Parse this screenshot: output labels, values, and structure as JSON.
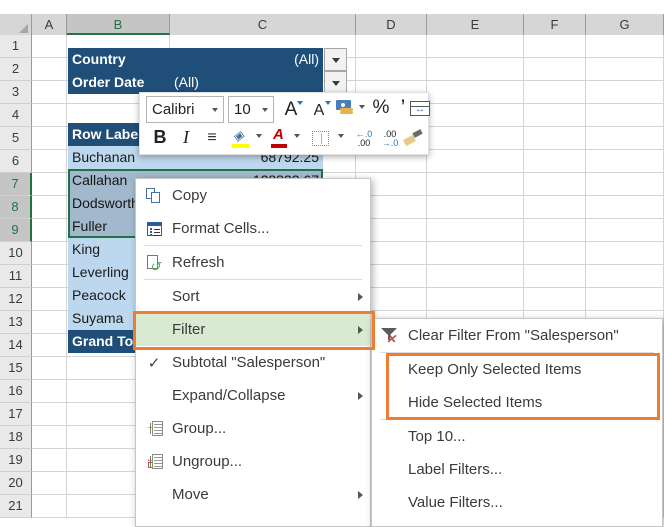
{
  "grid": {
    "columns": [
      "A",
      "B",
      "C",
      "D",
      "E",
      "F",
      "G"
    ],
    "selected_column": "B",
    "rows": [
      "1",
      "2",
      "3",
      "4",
      "5",
      "6",
      "7",
      "8",
      "9",
      "10",
      "11",
      "12",
      "13",
      "14",
      "15",
      "16",
      "17",
      "18",
      "19",
      "20",
      "21"
    ],
    "selected_rows": [
      "7",
      "8",
      "9"
    ]
  },
  "pivot": {
    "filters": [
      {
        "label": "Country",
        "value": "(All)"
      },
      {
        "label": "Order Date",
        "value": "(All)"
      }
    ],
    "header": "Row Labels",
    "rows": [
      {
        "name": "Buchanan",
        "value": "68792.25"
      },
      {
        "name": "Callahan",
        "value": "128833.67"
      },
      {
        "name": "Dodsworth",
        "value": ""
      },
      {
        "name": "Fuller",
        "value": ""
      },
      {
        "name": "King",
        "value": ""
      },
      {
        "name": "Leverling",
        "value": ""
      },
      {
        "name": "Peacock",
        "value": ""
      },
      {
        "name": "Suyama",
        "value": ""
      }
    ],
    "grand_total": "Grand Total"
  },
  "minitoolbar": {
    "font_name": "Calibri",
    "font_size": "10",
    "buttons": [
      {
        "name": "grow-font",
        "label": "A"
      },
      {
        "name": "shrink-font",
        "label": "A"
      },
      {
        "name": "accounting-number-format",
        "label": ""
      },
      {
        "name": "percent-style",
        "label": "%"
      },
      {
        "name": "comma-style",
        "label": "’"
      },
      {
        "name": "wrap-text",
        "label": ""
      },
      {
        "name": "bold",
        "label": "B"
      },
      {
        "name": "italic",
        "label": "I"
      },
      {
        "name": "center-align",
        "label": ""
      },
      {
        "name": "fill-color",
        "label": ""
      },
      {
        "name": "font-color",
        "label": "A"
      },
      {
        "name": "borders",
        "label": ""
      },
      {
        "name": "decrease-decimal",
        "label": ""
      },
      {
        "name": "increase-decimal",
        "label": ""
      },
      {
        "name": "format-painter",
        "label": ""
      }
    ],
    "decrease_decimal_top": "←.0",
    "decrease_decimal_bottom": ".00",
    "increase_decimal_top": ".00",
    "increase_decimal_bottom": "→.0"
  },
  "context_menu": {
    "items": [
      {
        "id": "copy",
        "label": "Copy",
        "icon": "copy-icon",
        "accel": "C",
        "submenu": false,
        "checked": false,
        "highlighted": false
      },
      {
        "id": "format",
        "label": "Format Cells...",
        "icon": "format-cells-icon",
        "accel": "F",
        "submenu": false,
        "checked": false,
        "highlighted": false
      },
      {
        "id": "refresh",
        "label": "Refresh",
        "icon": "refresh-icon",
        "accel": "R",
        "submenu": false,
        "checked": false,
        "highlighted": false
      },
      {
        "id": "sort",
        "label": "Sort",
        "icon": "",
        "accel": "S",
        "submenu": true,
        "checked": false,
        "highlighted": false
      },
      {
        "id": "filter",
        "label": "Filter",
        "icon": "",
        "accel": "t",
        "submenu": true,
        "checked": false,
        "highlighted": true
      },
      {
        "id": "subtotal",
        "label": "Subtotal \"Salesperson\"",
        "icon": "check-icon",
        "accel": "b",
        "submenu": false,
        "checked": true,
        "highlighted": false
      },
      {
        "id": "expand",
        "label": "Expand/Collapse",
        "icon": "",
        "accel": "E",
        "submenu": true,
        "checked": false,
        "highlighted": false
      },
      {
        "id": "group",
        "label": "Group...",
        "icon": "group-icon",
        "accel": "G",
        "submenu": false,
        "checked": false,
        "highlighted": false
      },
      {
        "id": "ungroup",
        "label": "Ungroup...",
        "icon": "ungroup-icon",
        "accel": "U",
        "submenu": false,
        "checked": false,
        "highlighted": false
      },
      {
        "id": "move",
        "label": "Move",
        "icon": "",
        "accel": "M",
        "submenu": true,
        "checked": false,
        "highlighted": false
      }
    ]
  },
  "filter_submenu": {
    "items": [
      {
        "id": "clear-filter",
        "label": "Clear Filter From \"Salesperson\"",
        "icon": "clear-filter-icon",
        "accel": "C"
      },
      {
        "id": "keep-only",
        "label": "Keep Only Selected Items",
        "icon": "",
        "accel": "K"
      },
      {
        "id": "hide-selected",
        "label": "Hide Selected Items",
        "icon": "",
        "accel": "H"
      },
      {
        "id": "top-10",
        "label": "Top 10...",
        "icon": "",
        "accel": "T"
      },
      {
        "id": "label-filters",
        "label": "Label Filters...",
        "icon": "",
        "accel": "L"
      },
      {
        "id": "value-filters",
        "label": "Value Filters...",
        "icon": "",
        "accel": "s"
      }
    ]
  },
  "colors": {
    "highlight": "#ED7D31",
    "pivot_header": "#1F4E79",
    "pivot_row": "#BDD7EE",
    "menu_highlight": "#D9EAD3",
    "excel_green": "#217346"
  }
}
